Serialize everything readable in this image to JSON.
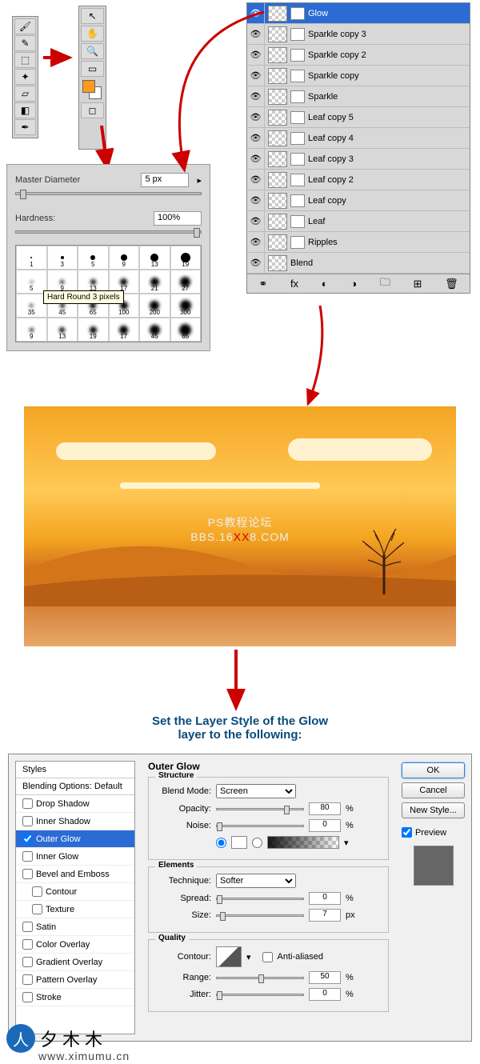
{
  "toolsA": [
    "brush-tool",
    "eyedropper-tool",
    "crop-tool",
    "clone-tool",
    "eraser-tool",
    "gradient-tool",
    "pen-tool"
  ],
  "toolsB": [
    "move-tool",
    "hand-tool",
    "zoom-tool",
    "note-tool"
  ],
  "brush_panel": {
    "diameter_label": "Master Diameter",
    "diameter_value": "5 px",
    "hardness_label": "Hardness:",
    "hardness_value": "100%",
    "tooltip": "Hard Round 3 pixels",
    "presets": [
      [
        "1",
        "3",
        "5",
        "9",
        "13",
        "19"
      ],
      [
        "5",
        "9",
        "13",
        "17",
        "21",
        "27"
      ],
      [
        "35",
        "45",
        "65",
        "100",
        "200",
        "300"
      ],
      [
        "9",
        "13",
        "19",
        "17",
        "45",
        "65"
      ]
    ]
  },
  "layers": [
    {
      "name": "Glow",
      "selected": true
    },
    {
      "name": "Sparkle copy 3"
    },
    {
      "name": "Sparkle copy 2"
    },
    {
      "name": "Sparkle copy"
    },
    {
      "name": "Sparkle"
    },
    {
      "name": "Leaf copy 5"
    },
    {
      "name": "Leaf copy 4"
    },
    {
      "name": "Leaf copy 3"
    },
    {
      "name": "Leaf copy 2"
    },
    {
      "name": "Leaf copy"
    },
    {
      "name": "Leaf"
    },
    {
      "name": "Ripples"
    },
    {
      "name": "Blend"
    }
  ],
  "watermark": {
    "line1": "PS教程论坛",
    "line2a": "BBS.16",
    "line2b": "XX",
    "line2c": "8.COM"
  },
  "instruction": {
    "line1": "Set the Layer Style of the Glow",
    "line2": "layer to the following:"
  },
  "layer_style": {
    "title": "Outer Glow",
    "styles_header": "Styles",
    "blending_options": "Blending Options: Default",
    "items": [
      {
        "label": "Drop Shadow",
        "checked": false
      },
      {
        "label": "Inner Shadow",
        "checked": false
      },
      {
        "label": "Outer Glow",
        "checked": true,
        "active": true
      },
      {
        "label": "Inner Glow",
        "checked": false
      },
      {
        "label": "Bevel and Emboss",
        "checked": false
      },
      {
        "label": "Contour",
        "checked": false,
        "sub": true
      },
      {
        "label": "Texture",
        "checked": false,
        "sub": true
      },
      {
        "label": "Satin",
        "checked": false
      },
      {
        "label": "Color Overlay",
        "checked": false
      },
      {
        "label": "Gradient Overlay",
        "checked": false
      },
      {
        "label": "Pattern Overlay",
        "checked": false
      },
      {
        "label": "Stroke",
        "checked": false
      }
    ],
    "structure": {
      "legend": "Structure",
      "blend_mode_label": "Blend Mode:",
      "blend_mode_value": "Screen",
      "opacity_label": "Opacity:",
      "opacity_value": "80",
      "opacity_unit": "%",
      "noise_label": "Noise:",
      "noise_value": "0",
      "noise_unit": "%"
    },
    "elements": {
      "legend": "Elements",
      "technique_label": "Technique:",
      "technique_value": "Softer",
      "spread_label": "Spread:",
      "spread_value": "0",
      "spread_unit": "%",
      "size_label": "Size:",
      "size_value": "7",
      "size_unit": "px"
    },
    "quality": {
      "legend": "Quality",
      "contour_label": "Contour:",
      "anti_aliased_label": "Anti-aliased",
      "range_label": "Range:",
      "range_value": "50",
      "range_unit": "%",
      "jitter_label": "Jitter:",
      "jitter_value": "0",
      "jitter_unit": "%"
    },
    "buttons": {
      "ok": "OK",
      "cancel": "Cancel",
      "new_style": "New Style...",
      "preview": "Preview"
    }
  },
  "footer": {
    "brand": "夕木木",
    "url": "www.ximumu.cn"
  }
}
